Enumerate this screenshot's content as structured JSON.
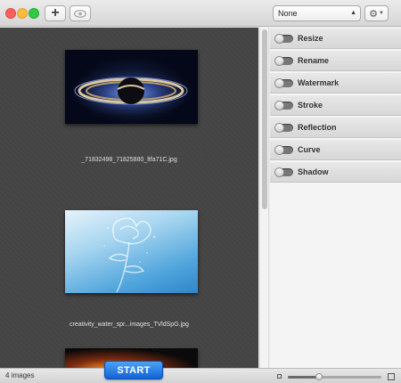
{
  "toolbar": {
    "add_icon": "plus-icon",
    "preview_icon": "eye-icon",
    "preset_select": "None",
    "settings_icon": "gear-icon"
  },
  "images": [
    {
      "filename": "_71832498_71825880_ltfa71C.jpg",
      "thumbnail": "saturn-eclipse"
    },
    {
      "filename": "creativity_water_spr...images_TVldSpG.jpg",
      "thumbnail": "water-rose"
    },
    {
      "filename": "",
      "thumbnail": "orange-glow"
    }
  ],
  "options": [
    {
      "label": "Resize",
      "enabled": false
    },
    {
      "label": "Rename",
      "enabled": false
    },
    {
      "label": "Watermark",
      "enabled": false
    },
    {
      "label": "Stroke",
      "enabled": false
    },
    {
      "label": "Reflection",
      "enabled": false
    },
    {
      "label": "Curve",
      "enabled": false
    },
    {
      "label": "Shadow",
      "enabled": false
    }
  ],
  "status": {
    "image_count": "4 images",
    "start_label": "START",
    "zoom_level": 0.33
  }
}
